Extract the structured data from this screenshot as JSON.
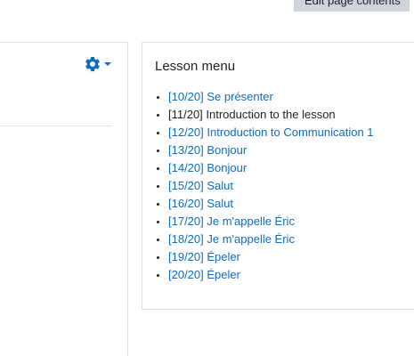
{
  "header": {
    "edit_button_label": "Edit page contents"
  },
  "main": {
    "settings_icon": "gear-icon",
    "dropdown_icon": "caret-down-icon",
    "accent_color": "#0f6cbf"
  },
  "lesson_menu": {
    "title": "Lesson menu",
    "items": [
      {
        "label": "[10/20] Se présenter",
        "current": false
      },
      {
        "label": "[11/20] Introduction to the lesson",
        "current": true
      },
      {
        "label": "[12/20] Introduction to Communication 1",
        "current": false
      },
      {
        "label": "[13/20] Bonjour",
        "current": false
      },
      {
        "label": "[14/20] Bonjour",
        "current": false
      },
      {
        "label": "[15/20] Salut",
        "current": false
      },
      {
        "label": "[16/20] Salut",
        "current": false
      },
      {
        "label": "[17/20] Je m'appelle Éric",
        "current": false
      },
      {
        "label": "[18/20] Je m'appelle Éric",
        "current": false
      },
      {
        "label": "[19/20] Épeler",
        "current": false
      },
      {
        "label": "[20/20] Épeler",
        "current": false
      }
    ]
  }
}
